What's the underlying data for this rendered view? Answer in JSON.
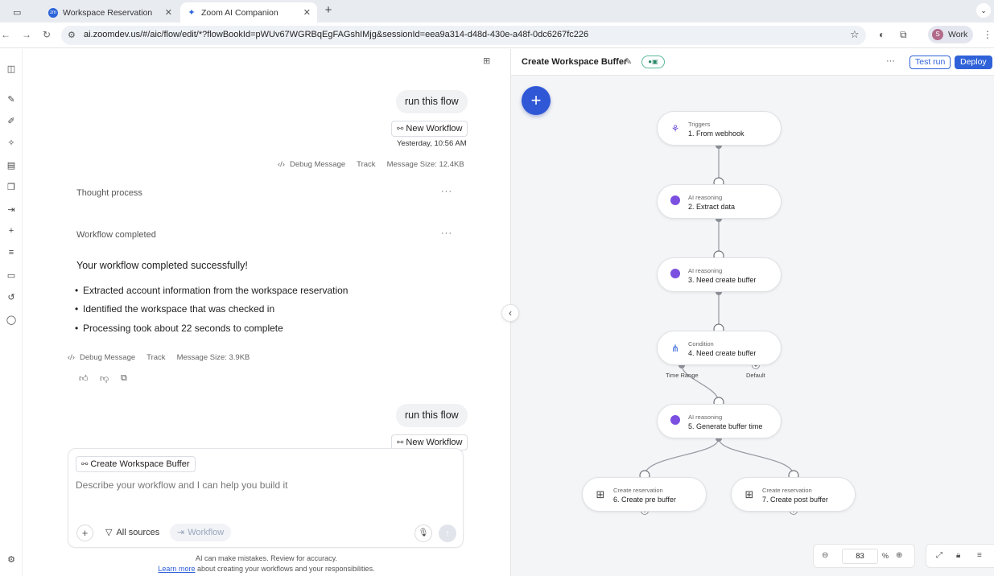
{
  "browser": {
    "tabs": [
      {
        "title": "Workspace Reservation",
        "favicon_text": "zm"
      },
      {
        "title": "Zoom AI Companion",
        "favicon_text": "✦"
      }
    ],
    "url": "ai.zoomdev.us/#/aic/flow/edit/*?flowBookId=pWUv67WGRBqEgFAGshIMjg&sessionId=eea9a314-d48d-430e-a48f-0dc6267fc226",
    "profile_initial": "S",
    "profile_name": "Work"
  },
  "chat": {
    "messages": [
      {
        "user_text": "run this flow",
        "chip": "New Workflow",
        "timestamp": "Yesterday, 10:56 AM"
      },
      {
        "user_text": "run this flow",
        "chip": "New Workflow"
      }
    ],
    "meta1": {
      "debug": "Debug Message",
      "track": "Track",
      "size": "Message Size: 12.4KB"
    },
    "thought_process": "Thought process",
    "workflow_completed": "Workflow completed",
    "result_heading": "Your workflow completed successfully!",
    "bullets": [
      "Extracted account information from the workspace reservation",
      "Identified the workspace that was checked in",
      "Processing took about 22 seconds to complete"
    ],
    "meta2": {
      "debug": "Debug Message",
      "track": "Track",
      "size": "Message Size: 3.9KB"
    },
    "composer": {
      "tag": "Create Workspace Buffer",
      "placeholder": "Describe your workflow and I can help you build it",
      "sources": "All sources",
      "workflow": "Workflow"
    },
    "disclaimer_line1": "AI can make mistakes. Review for accuracy.",
    "disclaimer_link": "Learn more",
    "disclaimer_rest": " about creating your workflows and your responsibilities."
  },
  "flow": {
    "title": "Create Workspace Buffer",
    "test_run": "Test run",
    "deploy": "Deploy",
    "accent": "#2f62d8",
    "nodes": [
      {
        "category": "Triggers",
        "label": "1. From webhook",
        "icon": "webhook-icon"
      },
      {
        "category": "AI reasoning",
        "label": "2. Extract data",
        "icon": "ai-reasoning-icon"
      },
      {
        "category": "AI reasoning",
        "label": "3. Need create buffer",
        "icon": "ai-reasoning-icon"
      },
      {
        "category": "Condition",
        "label": "4. Need create buffer",
        "icon": "condition-icon"
      },
      {
        "category": "AI reasoning",
        "label": "5. Generate buffer time",
        "icon": "ai-reasoning-icon"
      },
      {
        "category": "Create reservation",
        "label": "6. Create pre buffer",
        "icon": "grid-icon"
      },
      {
        "category": "Create reservation",
        "label": "7. Create post buffer",
        "icon": "grid-icon"
      }
    ],
    "branch_labels": {
      "left": "Time Range",
      "right": "Default"
    },
    "zoom": "83",
    "zoom_unit": "%"
  }
}
